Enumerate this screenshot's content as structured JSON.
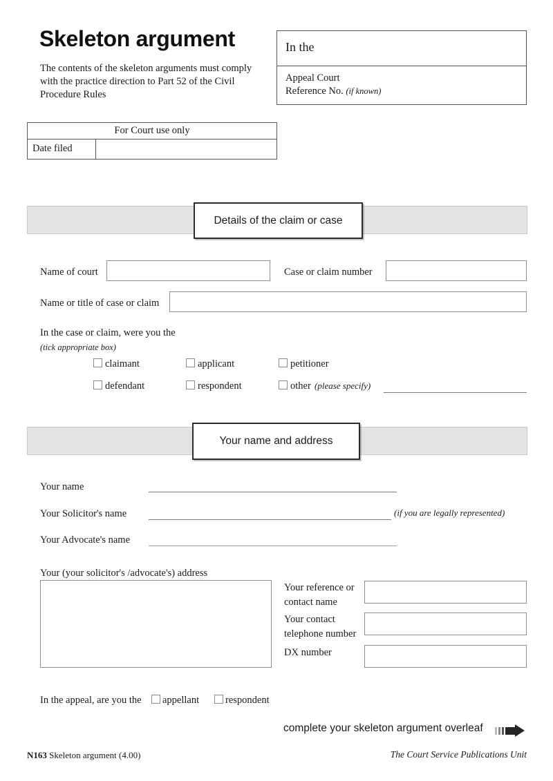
{
  "form": {
    "title": "Skeleton argument",
    "subtitle": "The contents of the skeleton arguments must comply with the practice direction to Part 52 of the Civil Procedure Rules",
    "in_the_label": "In the",
    "appeal_court_label": "Appeal Court",
    "reference_no_label": "Reference No.",
    "reference_no_note": "(if known)"
  },
  "court_use": {
    "header": "For Court use only",
    "date_filed_label": "Date filed",
    "date_filed_value": ""
  },
  "sections": {
    "details": {
      "heading": "Details of the claim or case",
      "name_of_court_label": "Name of court",
      "name_of_court_value": "",
      "case_number_label": "Case or claim number",
      "case_number_value": "",
      "case_title_label": "Name or title of case or claim",
      "case_title_value": "",
      "role_question": "In the case or claim, were you the",
      "role_hint": "(tick appropriate box)",
      "role_options": [
        {
          "label": "claimant"
        },
        {
          "label": "applicant"
        },
        {
          "label": "petitioner"
        },
        {
          "label": "defendant"
        },
        {
          "label": "respondent"
        },
        {
          "label": "other"
        }
      ],
      "other_note": "(please specify)",
      "other_value": ""
    },
    "name_address": {
      "heading": "Your name and address",
      "your_name_label": "Your name",
      "your_name_value": "",
      "solicitor_name_label": "Your Solicitor's name",
      "solicitor_name_value": "",
      "solicitor_note": "(if you are legally represented)",
      "advocate_name_label": "Your Advocate's name",
      "advocate_name_value": "",
      "address_label": "Your (your solicitor's /advocate's) address",
      "address_value": "",
      "reference_label": "Your reference or contact name",
      "reference_value": "",
      "telephone_label": "Your contact telephone number",
      "telephone_value": "",
      "dx_label": "DX number",
      "dx_value": "",
      "appeal_question": "In the appeal, are you the",
      "appeal_options": [
        {
          "label": "appellant"
        },
        {
          "label": "respondent"
        }
      ]
    }
  },
  "footer": {
    "overleaf_text": "complete your skeleton argument overleaf",
    "arrow_icon": "right-arrow-icon",
    "form_code": "N163",
    "form_name": "Skeleton argument (4.00)",
    "publisher": "The Court Service Publications Unit"
  },
  "colors": {
    "band_background": "#e3e3e3",
    "band_border": "#c9c9c9",
    "field_border": "#8f8f8f",
    "text": "#1a1a1a"
  }
}
